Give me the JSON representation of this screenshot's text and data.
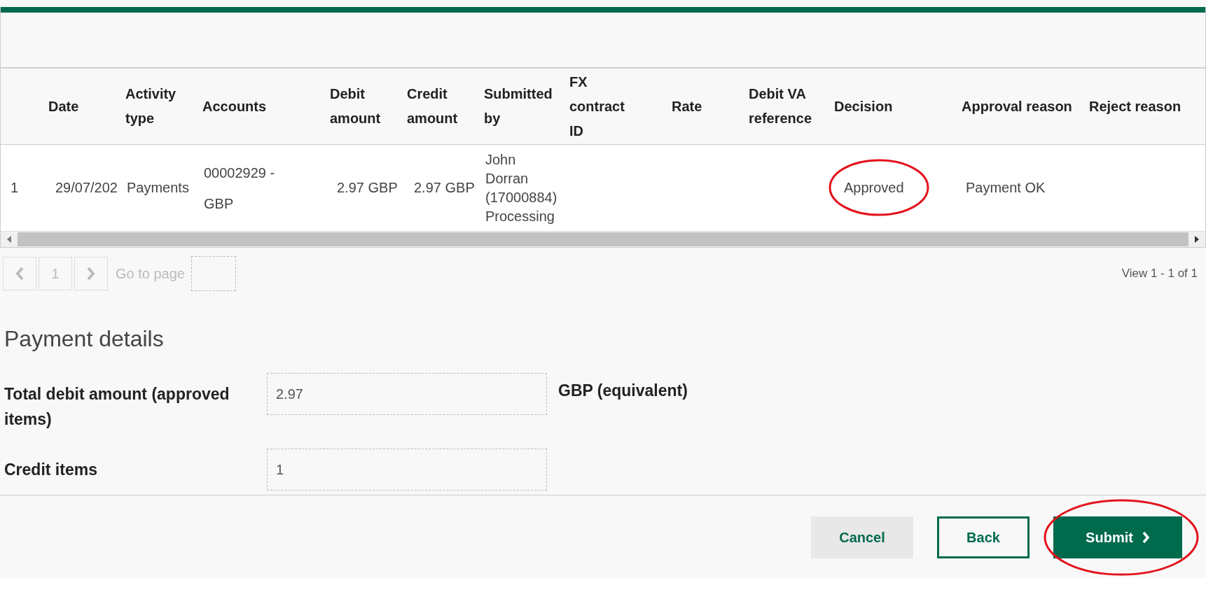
{
  "table": {
    "columns": [
      null,
      "Date",
      "Activity type",
      "Accounts",
      "Debit amount",
      "Credit amount",
      "Submitted by",
      "FX contract ID",
      "Rate",
      "Debit VA reference",
      "Decision",
      "Approval reason",
      "Reject reason"
    ],
    "rows": [
      {
        "cells": [
          "1",
          "29/07/202",
          "Payments",
          "00002929 - GBP",
          "2.97 GBP",
          "2.97 GBP",
          "John Dorran (17000884) Processing",
          null,
          null,
          null,
          "Approved",
          "Payment OK",
          null
        ]
      }
    ]
  },
  "pagination": {
    "page": "1",
    "goto_label": "Go to page",
    "summary": "View 1 - 1 of 1"
  },
  "payment_details": {
    "title": "Payment details",
    "fields": [
      {
        "label": "Total debit amount (approved items)",
        "value": "2.97",
        "suffix": "GBP (equivalent)"
      },
      {
        "label": "Credit items",
        "value": "1"
      }
    ]
  },
  "buttons": [
    {
      "kind": "secondary",
      "label": "Cancel"
    },
    {
      "kind": "outline",
      "label": "Back"
    },
    {
      "kind": "primary",
      "label": "Submit"
    }
  ]
}
